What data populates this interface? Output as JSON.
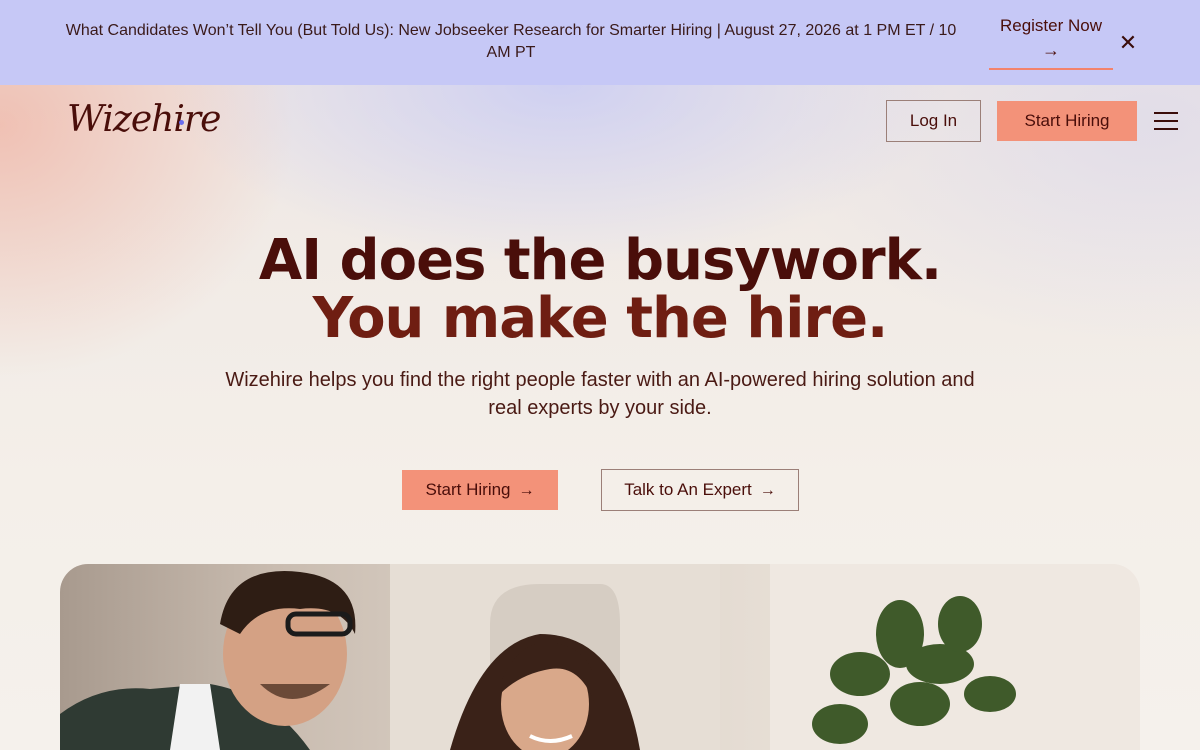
{
  "announcement": {
    "text": "What Candidates Won’t Tell You (But Told Us): New Jobseeker Research for Smarter Hiring | August 27, 2026 at 1 PM ET / 10 AM PT",
    "register_label": "Register Now",
    "register_arrow": "→",
    "close_glyph": "✕"
  },
  "header": {
    "logo_text": "Wizehire",
    "login_label": "Log In",
    "start_label": "Start Hiring"
  },
  "hero": {
    "headline_line1": "AI does the busywork.",
    "headline_line2": "You make the hire.",
    "subheadline": "Wizehire helps you find the right people faster with an AI-powered hiring solution and real experts by your side.",
    "cta_primary": "Start Hiring",
    "cta_secondary": "Talk to An Expert",
    "cta_arrow": "→"
  },
  "colors": {
    "announcement_bg": "#c6c8f6",
    "accent": "#f39279",
    "text_dark": "#4a0e0a"
  },
  "icons": [
    "close-icon",
    "arrow-right-icon",
    "hamburger-menu-icon"
  ]
}
